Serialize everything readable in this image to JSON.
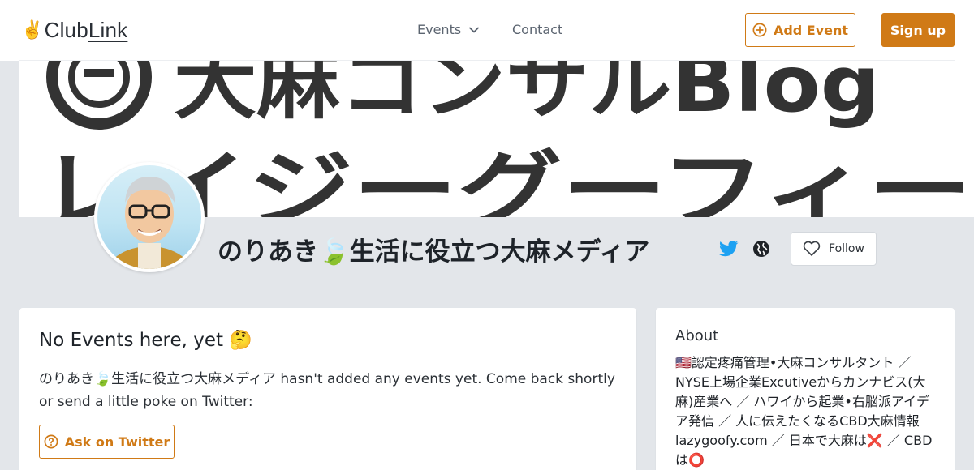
{
  "header": {
    "logo_hand": "✌️",
    "logo_club": "Club",
    "logo_link": "Link",
    "nav_events": "Events",
    "nav_contact": "Contact",
    "add_event_label": "Add Event",
    "signup_label": "Sign up"
  },
  "banner": {
    "line1": "大麻コンサルBlog",
    "line2": "レイジーグーフィー"
  },
  "profile": {
    "name": "のりあき🍃生活に役立つ大麻メディア",
    "follow_label": "Follow"
  },
  "events": {
    "title": "No Events here, yet 🤔",
    "message": "のりあき🍃生活に役立つ大麻メディア hasn't added any events yet. Come back shortly or send a little poke on Twitter:",
    "ask_label": "Ask on Twitter"
  },
  "about": {
    "title": "About",
    "text": "🇺🇸認定疼痛管理•大麻コンサルタント ／ NYSE上場企業Excutiveからカンナビス(大麻)産業へ ／ ハワイから起業•右脳派アイデア発信 ／ 人に伝えたくなるCBD大麻情報 lazygoofy.com ／ 日本で大麻は❌ ／ CBDは⭕"
  },
  "colors": {
    "accent": "#d07a16",
    "twitter": "#1da1f2",
    "background": "#e3e6ea"
  }
}
